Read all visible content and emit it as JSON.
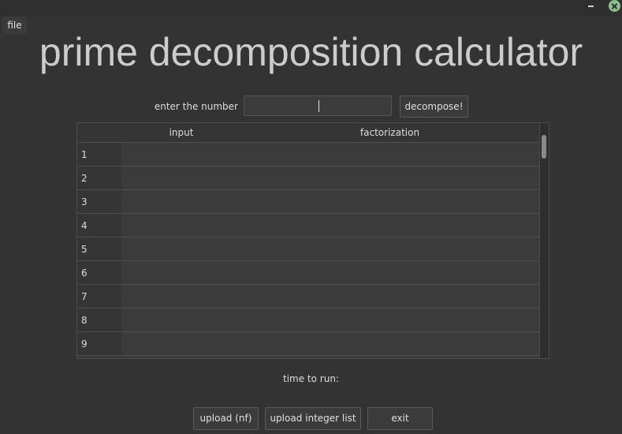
{
  "menu": {
    "file_label": "file"
  },
  "app": {
    "title": "prime decomposition calculator"
  },
  "entry": {
    "label": "enter the number",
    "value": "",
    "decompose_label": "decompose!"
  },
  "table": {
    "columns": [
      "input",
      "factorization"
    ],
    "rows": [
      {
        "n": "1",
        "input": "",
        "factorization": ""
      },
      {
        "n": "2",
        "input": "",
        "factorization": ""
      },
      {
        "n": "3",
        "input": "",
        "factorization": ""
      },
      {
        "n": "4",
        "input": "",
        "factorization": ""
      },
      {
        "n": "5",
        "input": "",
        "factorization": ""
      },
      {
        "n": "6",
        "input": "",
        "factorization": ""
      },
      {
        "n": "7",
        "input": "",
        "factorization": ""
      },
      {
        "n": "8",
        "input": "",
        "factorization": ""
      },
      {
        "n": "9",
        "input": "",
        "factorization": ""
      }
    ]
  },
  "status": {
    "time_label": "time to run:"
  },
  "footer": {
    "upload_nf_label": "upload (nf)",
    "upload_list_label": "upload integer list",
    "exit_label": "exit"
  },
  "colors": {
    "background": "#333333",
    "accent_close": "#8fbf8f"
  }
}
